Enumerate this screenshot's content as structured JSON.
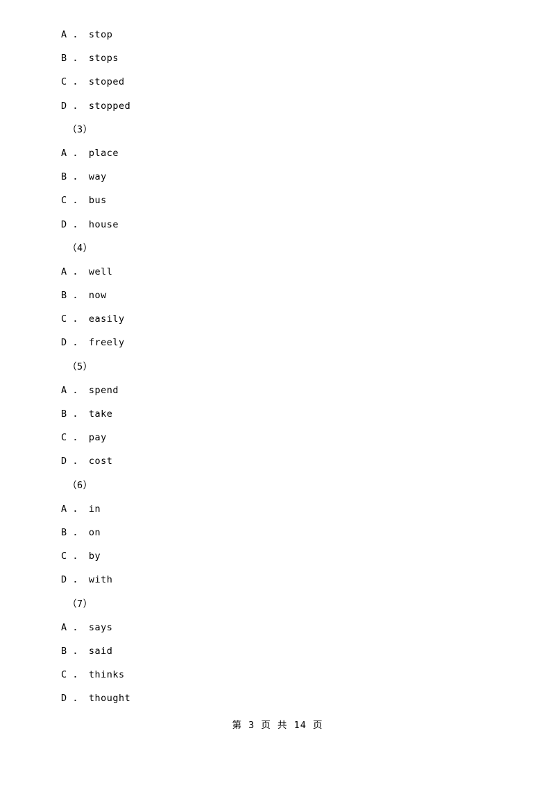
{
  "document": {
    "lines": [
      {
        "type": "option",
        "text": "A ． stop"
      },
      {
        "type": "option",
        "text": "B ． stops"
      },
      {
        "type": "option",
        "text": "C ． stoped"
      },
      {
        "type": "option",
        "text": "D ． stopped"
      },
      {
        "type": "question",
        "text": "（3）"
      },
      {
        "type": "option",
        "text": "A ． place"
      },
      {
        "type": "option",
        "text": "B ． way"
      },
      {
        "type": "option",
        "text": "C ． bus"
      },
      {
        "type": "option",
        "text": "D ． house"
      },
      {
        "type": "question",
        "text": "（4）"
      },
      {
        "type": "option",
        "text": "A ． well"
      },
      {
        "type": "option",
        "text": "B ． now"
      },
      {
        "type": "option",
        "text": "C ． easily"
      },
      {
        "type": "option",
        "text": "D ． freely"
      },
      {
        "type": "question",
        "text": "（5）"
      },
      {
        "type": "option",
        "text": "A ． spend"
      },
      {
        "type": "option",
        "text": "B ． take"
      },
      {
        "type": "option",
        "text": "C ． pay"
      },
      {
        "type": "option",
        "text": "D ． cost"
      },
      {
        "type": "question",
        "text": "（6）"
      },
      {
        "type": "option",
        "text": "A ． in"
      },
      {
        "type": "option",
        "text": "B ． on"
      },
      {
        "type": "option",
        "text": "C ． by"
      },
      {
        "type": "option",
        "text": "D ． with"
      },
      {
        "type": "question",
        "text": "（7）"
      },
      {
        "type": "option",
        "text": "A ． says"
      },
      {
        "type": "option",
        "text": "B ． said"
      },
      {
        "type": "option",
        "text": "C ． thinks"
      },
      {
        "type": "option",
        "text": "D ． thought"
      }
    ],
    "footer": "第 3 页 共 14 页"
  }
}
